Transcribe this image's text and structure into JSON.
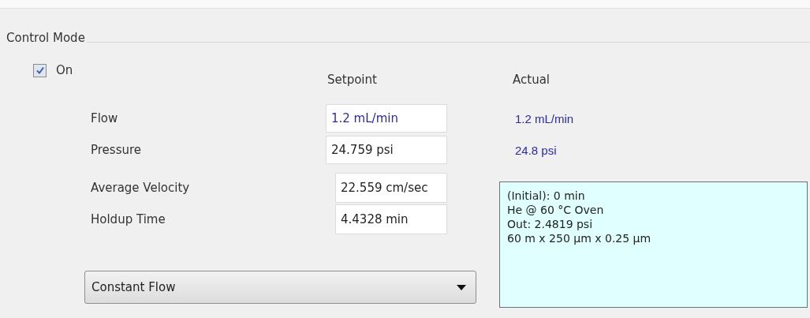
{
  "group": {
    "title": "Control Mode"
  },
  "enable": {
    "label": "On",
    "checked": true
  },
  "columns": [
    "Setpoint",
    "Actual"
  ],
  "parameters": [
    {
      "label": "Flow",
      "setpoint": "1.2 mL/min",
      "highlighted": true,
      "actual": "1.2 mL/min"
    },
    {
      "label": "Pressure",
      "setpoint": "24.759 psi",
      "highlighted": false,
      "actual": "24.8 psi"
    },
    {
      "label": "Average Velocity",
      "setpoint": "22.559 cm/sec",
      "highlighted": false
    },
    {
      "label": "Holdup Time",
      "setpoint": "4.4328 min",
      "highlighted": false
    }
  ],
  "mode_dropdown": {
    "value": "Constant Flow"
  },
  "info_lines": [
    "(Initial): 0 min",
    "He @ 60 °C Oven",
    "Out: 2.4819 psi",
    "60 m x 250 µm x 0.25 µm"
  ]
}
